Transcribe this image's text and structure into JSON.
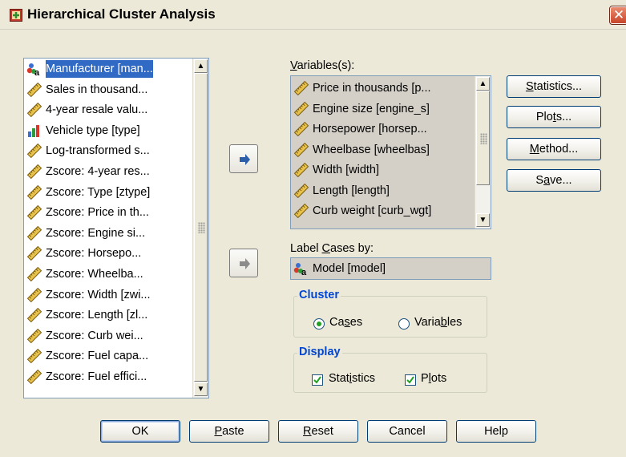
{
  "window": {
    "title": "Hierarchical Cluster Analysis",
    "close_glyph": "✕"
  },
  "source_list": {
    "items": [
      {
        "label": "Manufacturer [man...",
        "icon": "nominal-string-icon",
        "selected": true
      },
      {
        "label": "Sales in thousand...",
        "icon": "scale-ruler-icon"
      },
      {
        "label": "4-year resale valu...",
        "icon": "scale-ruler-icon"
      },
      {
        "label": "Vehicle type [type]",
        "icon": "ordinal-bar-icon"
      },
      {
        "label": "Log-transformed s...",
        "icon": "scale-ruler-icon"
      },
      {
        "label": "Zscore:  4-year res...",
        "icon": "scale-ruler-icon"
      },
      {
        "label": "Zscore:  Type [ztype]",
        "icon": "scale-ruler-icon"
      },
      {
        "label": "Zscore:  Price in th...",
        "icon": "scale-ruler-icon"
      },
      {
        "label": "Zscore:  Engine si...",
        "icon": "scale-ruler-icon"
      },
      {
        "label": "Zscore:  Horsepo...",
        "icon": "scale-ruler-icon"
      },
      {
        "label": "Zscore:  Wheelba...",
        "icon": "scale-ruler-icon"
      },
      {
        "label": "Zscore:  Width [zwi...",
        "icon": "scale-ruler-icon"
      },
      {
        "label": "Zscore:  Length [zl...",
        "icon": "scale-ruler-icon"
      },
      {
        "label": "Zscore:  Curb wei...",
        "icon": "scale-ruler-icon"
      },
      {
        "label": "Zscore:  Fuel capa...",
        "icon": "scale-ruler-icon"
      },
      {
        "label": "Zscore:  Fuel effici...",
        "icon": "scale-ruler-icon"
      }
    ]
  },
  "variables": {
    "label_prefix": "",
    "label_u": "V",
    "label_rest": "ariables(s):",
    "items": [
      {
        "label": "Price in thousands [p...",
        "icon": "scale-ruler-icon"
      },
      {
        "label": "Engine size [engine_s]",
        "icon": "scale-ruler-icon"
      },
      {
        "label": "Horsepower [horsep...",
        "icon": "scale-ruler-icon"
      },
      {
        "label": "Wheelbase [wheelbas]",
        "icon": "scale-ruler-icon"
      },
      {
        "label": "Width [width]",
        "icon": "scale-ruler-icon"
      },
      {
        "label": "Length [length]",
        "icon": "scale-ruler-icon"
      },
      {
        "label": "Curb weight [curb_wgt]",
        "icon": "scale-ruler-icon"
      }
    ]
  },
  "label_cases": {
    "label_pre": "Label ",
    "label_u": "C",
    "label_rest": "ases by:",
    "value": "Model [model]",
    "icon": "nominal-string-icon"
  },
  "cluster": {
    "title": "Cluster",
    "cases_pre": "Ca",
    "cases_u": "s",
    "cases_rest": "es",
    "variables_pre": "Varia",
    "variables_u": "b",
    "variables_rest": "les",
    "selected": "cases"
  },
  "display": {
    "title": "Display",
    "statistics_pre": "Stat",
    "statistics_u": "i",
    "statistics_rest": "stics",
    "plots_pre": "P",
    "plots_u": "l",
    "plots_rest": "ots",
    "statistics_checked": true,
    "plots_checked": true
  },
  "side_buttons": {
    "statistics_u": "S",
    "statistics_rest": "tatistics...",
    "plots_pre": "Plo",
    "plots_u": "t",
    "plots_rest": "s...",
    "method_u": "M",
    "method_rest": "ethod...",
    "save_pre": "S",
    "save_u": "a",
    "save_rest": "ve..."
  },
  "bottom_buttons": {
    "ok": "OK",
    "paste_u": "P",
    "paste_rest": "aste",
    "reset_u": "R",
    "reset_rest": "eset",
    "cancel": "Cancel",
    "help": "Help"
  },
  "colors": {
    "selection": "#316ac5",
    "group_title": "#0046d5",
    "arrow_active": "#2a5ea8",
    "arrow_inactive": "#8c8c8c"
  }
}
